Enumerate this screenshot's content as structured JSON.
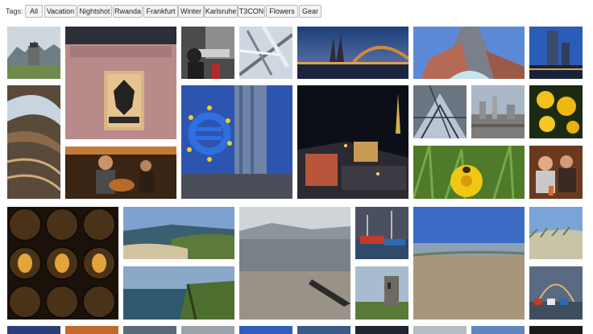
{
  "tags": {
    "label": "Tags:",
    "items": [
      "All",
      "Vacation",
      "Nightshot",
      "Rwanda",
      "Frankfurt",
      "Winter",
      "Karlsruhe",
      "T3CON",
      "Flowers",
      "Gear"
    ]
  },
  "gallery": {
    "photos": [
      {
        "subject": "espresso-maker-mountain-lake"
      },
      {
        "subject": "bundesgerichtshof-sign"
      },
      {
        "subject": "photographer-with-telephoto-lens"
      },
      {
        "subject": "frosty-branches"
      },
      {
        "subject": "cologne-cathedral-night"
      },
      {
        "subject": "glass-skyscraper-frankfurt"
      },
      {
        "subject": "city-skyline-blue-hour"
      },
      {
        "subject": "curved-glass-roof-interior"
      },
      {
        "subject": "euro-sign-ecb-tower"
      },
      {
        "subject": "city-aerial-night"
      },
      {
        "subject": "glass-roof-geometry"
      },
      {
        "subject": "frankfurt-panorama-day"
      },
      {
        "subject": "yellow-flowers-dark"
      },
      {
        "subject": "guitarist-in-bar"
      },
      {
        "subject": "dandelion-with-bee"
      },
      {
        "subject": "people-in-restaurant"
      },
      {
        "subject": "whiskey-barrels"
      },
      {
        "subject": "coastline-bay"
      },
      {
        "subject": "misty-beach-sea"
      },
      {
        "subject": "harbor-boats"
      },
      {
        "subject": "wide-sandy-beach"
      },
      {
        "subject": "dune-grass"
      },
      {
        "subject": "cliffs-over-sea"
      },
      {
        "subject": "ruined-tower-on-coast"
      },
      {
        "subject": "rainbow-over-village"
      }
    ]
  }
}
